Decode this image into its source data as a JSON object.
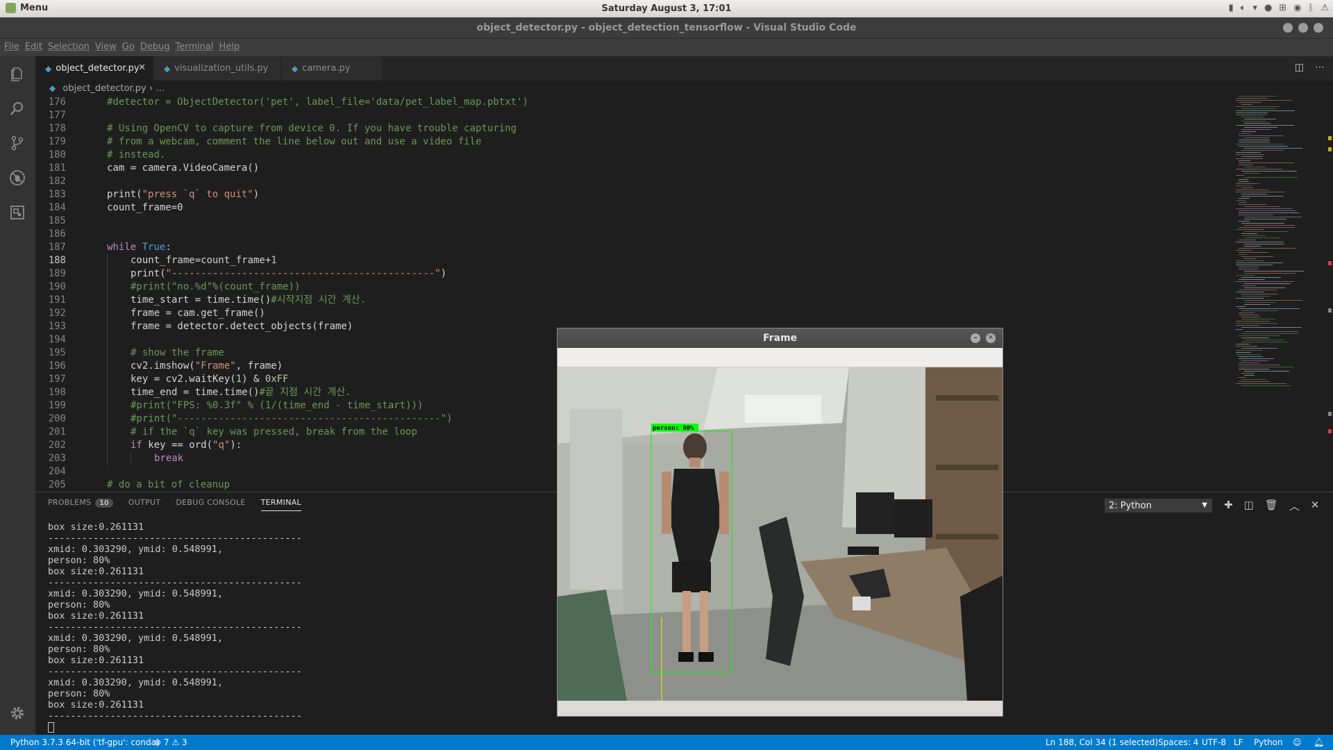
{
  "os": {
    "menu_label": "Menu",
    "clock": "Saturday August  3, 17:01"
  },
  "window": {
    "title": "object_detector.py - object_detection_tensorflow - Visual Studio Code"
  },
  "menu": [
    "File",
    "Edit",
    "Selection",
    "View",
    "Go",
    "Debug",
    "Terminal",
    "Help"
  ],
  "activity": [
    "explorer-icon",
    "search-icon",
    "source-control-icon",
    "debug-icon",
    "extensions-icon",
    "gear-icon"
  ],
  "tabs": [
    {
      "label": "object_detector.py",
      "active": true
    },
    {
      "label": "visualization_utils.py",
      "active": false
    },
    {
      "label": "camera.py",
      "active": false
    }
  ],
  "breadcrumb": {
    "file": "object_detector.py",
    "rest": "…"
  },
  "editor": {
    "current_line": "188",
    "lines": [
      {
        "n": "176",
        "tokens": [
          [
            "cm",
            "#detector = ObjectDetector('pet', label_file='data/pet_label_map.pbtxt')"
          ]
        ],
        "indent": 1
      },
      {
        "n": "177",
        "tokens": [],
        "indent": 1
      },
      {
        "n": "178",
        "tokens": [
          [
            "cm",
            "# Using OpenCV to capture from device 0. If you have trouble capturing"
          ]
        ],
        "indent": 1
      },
      {
        "n": "179",
        "tokens": [
          [
            "cm",
            "# from a webcam, comment the line below out and use a video file"
          ]
        ],
        "indent": 1
      },
      {
        "n": "180",
        "tokens": [
          [
            "cm",
            "# instead."
          ]
        ],
        "indent": 1
      },
      {
        "n": "181",
        "tokens": [
          [
            "",
            "cam = camera.VideoCamera()"
          ]
        ],
        "indent": 1
      },
      {
        "n": "182",
        "tokens": [],
        "indent": 1
      },
      {
        "n": "183",
        "tokens": [
          [
            "",
            "print("
          ],
          [
            "st",
            "\"press `q` to quit\""
          ],
          [
            "",
            ")"
          ]
        ],
        "indent": 1
      },
      {
        "n": "184",
        "tokens": [
          [
            "",
            "count_frame=0"
          ]
        ],
        "indent": 1
      },
      {
        "n": "185",
        "tokens": [],
        "indent": 1
      },
      {
        "n": "186",
        "tokens": [],
        "indent": 1
      },
      {
        "n": "187",
        "tokens": [
          [
            "kw",
            "while"
          ],
          [
            "",
            " "
          ],
          [
            "bl",
            "True"
          ],
          [
            "",
            ":"
          ]
        ],
        "indent": 1
      },
      {
        "n": "188",
        "tokens": [
          [
            "",
            "count_frame=count_frame+"
          ],
          [
            "nm",
            "1"
          ]
        ],
        "indent": 2
      },
      {
        "n": "189",
        "tokens": [
          [
            "",
            "print("
          ],
          [
            "st",
            "\"---------------------------------------------\""
          ],
          [
            "",
            ")"
          ]
        ],
        "indent": 2
      },
      {
        "n": "190",
        "tokens": [
          [
            "cm",
            "#print(\"no.%d\"%(count_frame))"
          ]
        ],
        "indent": 2
      },
      {
        "n": "191",
        "tokens": [
          [
            "",
            "time_start = time.time()"
          ],
          [
            "cm",
            "#시작지점 시간 계산."
          ]
        ],
        "indent": 2
      },
      {
        "n": "192",
        "tokens": [
          [
            "",
            "frame = cam.get_frame()"
          ]
        ],
        "indent": 2
      },
      {
        "n": "193",
        "tokens": [
          [
            "",
            "frame = detector.detect_objects(frame)"
          ]
        ],
        "indent": 2
      },
      {
        "n": "194",
        "tokens": [],
        "indent": 2
      },
      {
        "n": "195",
        "tokens": [
          [
            "cm",
            "# show the frame"
          ]
        ],
        "indent": 2
      },
      {
        "n": "196",
        "tokens": [
          [
            "",
            "cv2.imshow("
          ],
          [
            "st",
            "\"Frame\""
          ],
          [
            "",
            ", frame)"
          ]
        ],
        "indent": 2
      },
      {
        "n": "197",
        "tokens": [
          [
            "",
            "key = cv2.waitKey("
          ],
          [
            "nm",
            "1"
          ],
          [
            "",
            ") & "
          ],
          [
            "nm",
            "0xFF"
          ]
        ],
        "indent": 2
      },
      {
        "n": "198",
        "tokens": [
          [
            "",
            "time_end = time.time()"
          ],
          [
            "cm",
            "#끝 지점 시간 계산."
          ]
        ],
        "indent": 2
      },
      {
        "n": "199",
        "tokens": [
          [
            "cm",
            "#print(\"FPS: %0.3f\" % (1/(time_end - time_start)))"
          ]
        ],
        "indent": 2
      },
      {
        "n": "200",
        "tokens": [
          [
            "cm",
            "#print(\"---------------------------------------------\")"
          ]
        ],
        "indent": 2
      },
      {
        "n": "201",
        "tokens": [
          [
            "cm",
            "# if the `q` key was pressed, break from the loop"
          ]
        ],
        "indent": 2
      },
      {
        "n": "202",
        "tokens": [
          [
            "kw",
            "if"
          ],
          [
            "",
            " key == ord("
          ],
          [
            "st",
            "\"q\""
          ],
          [
            "",
            "):"
          ]
        ],
        "indent": 2
      },
      {
        "n": "203",
        "tokens": [
          [
            "kw",
            "break"
          ]
        ],
        "indent": 3
      },
      {
        "n": "204",
        "tokens": [],
        "indent": 1
      },
      {
        "n": "205",
        "tokens": [
          [
            "cm",
            "# do a bit of cleanup"
          ]
        ],
        "indent": 1
      }
    ]
  },
  "panel": {
    "tabs": [
      {
        "label": "PROBLEMS",
        "badge": "10"
      },
      {
        "label": "OUTPUT"
      },
      {
        "label": "DEBUG CONSOLE"
      },
      {
        "label": "TERMINAL",
        "active": true
      }
    ],
    "terminal_select": "2: Python",
    "terminal_lines": [
      "box size:0.261131",
      "---------------------------------------------",
      "xmid: 0.303290, ymid: 0.548991,",
      "person: 80%",
      "box size:0.261131",
      "---------------------------------------------",
      "xmid: 0.303290, ymid: 0.548991,",
      "person: 80%",
      "box size:0.261131",
      "---------------------------------------------",
      "xmid: 0.303290, ymid: 0.548991,",
      "person: 80%",
      "box size:0.261131",
      "---------------------------------------------",
      "xmid: 0.303290, ymid: 0.548991,",
      "person: 80%",
      "box size:0.261131",
      "---------------------------------------------"
    ]
  },
  "status": {
    "interpreter": "Python 3.7.3 64-bit ('tf-gpu': conda)",
    "errors": "7",
    "warnings": "3",
    "position": "Ln 188, Col 34 (1 selected)",
    "spaces": "Spaces: 4",
    "encoding": "UTF-8",
    "eol": "LF",
    "language": "Python"
  },
  "frame_window": {
    "title": "Frame",
    "detection_label": "person: 80%",
    "box_color": "#00ff00"
  },
  "colors": {
    "accent": "#007acc",
    "comment": "#6a9955",
    "string": "#ce9178",
    "keyword": "#c586c0"
  }
}
